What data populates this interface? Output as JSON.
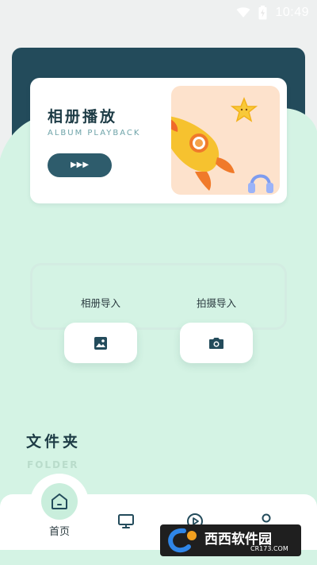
{
  "status_bar": {
    "time": "10:49",
    "wifi_icon": "wifi-icon",
    "battery_icon": "battery-charging-icon"
  },
  "album_card": {
    "title": "相册播放",
    "subtitle": "ALBUM PLAYBACK",
    "play_button_glyph": "▶▶▶",
    "illustration": "rocket-illustration"
  },
  "import": {
    "album_label": "相册导入",
    "camera_label": "拍摄导入",
    "album_icon": "image-icon",
    "camera_icon": "camera-icon"
  },
  "folder": {
    "title": "文件夹",
    "subtitle": "FOLDER"
  },
  "bottom_nav": {
    "items": [
      {
        "label": "首页",
        "icon": "home-icon",
        "active": true
      },
      {
        "label": "",
        "icon": "monitor-icon",
        "active": false
      },
      {
        "label": "",
        "icon": "play-circle-icon",
        "active": false
      },
      {
        "label": "",
        "icon": "user-icon",
        "active": false
      }
    ]
  },
  "watermark": {
    "text": "西西软件园",
    "url": "CR173.COM"
  },
  "colors": {
    "header_dark": "#234b5b",
    "mint": "#d4f3e4",
    "accent_button": "#2e5c6c",
    "rocket_panel": "#fde2cc",
    "home_active": "#c9eedc"
  }
}
